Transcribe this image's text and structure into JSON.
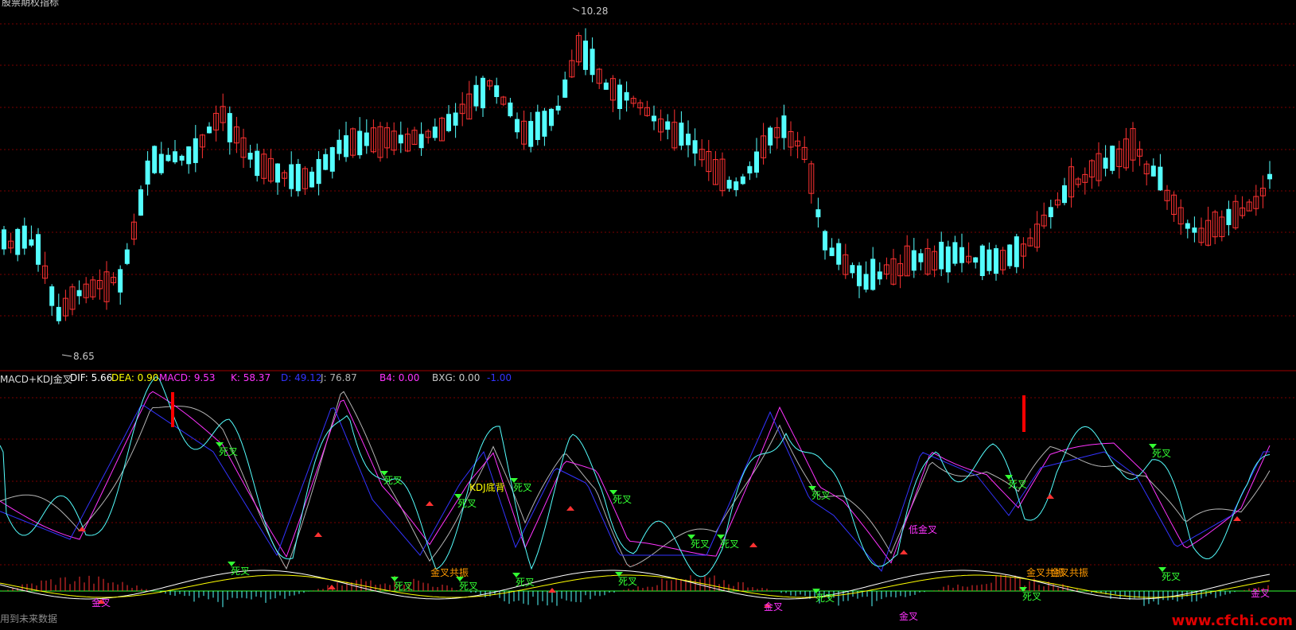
{
  "price_panel": {
    "header_cut": "股票期权指标",
    "high_label": "10.28",
    "low_label": "8.65"
  },
  "indicator_bar": {
    "name": "MACD+KDJ金叉",
    "dif": "DIF: 5.66",
    "dea": "DEA: 0.90",
    "macd": "MACD: 9.53",
    "k": "K: 58.37",
    "d": "D: 49.12",
    "j": "J: 76.87",
    "b4": "B4: 0.00",
    "bxg": "BXG: 0.00",
    "extra": "-1.00"
  },
  "signals": {
    "sicha": "死叉",
    "jincha": "金叉",
    "di_jincha": "低金叉",
    "kdj_dibei": "KDJ底背",
    "gongzhen": "金叉共振"
  },
  "footer_note": "用到未来数据",
  "watermark": "www.cfchi.com",
  "colors": {
    "up": "#ff3232",
    "down": "#54ffff",
    "grid": "#7a0000",
    "k_line": "#ff33ff",
    "d_line": "#3333ff",
    "j_line": "#b4b4b4",
    "dif": "#ffffff",
    "dea": "#ffff00",
    "label_green": "#33ff33",
    "label_orange": "#ff9900"
  }
}
